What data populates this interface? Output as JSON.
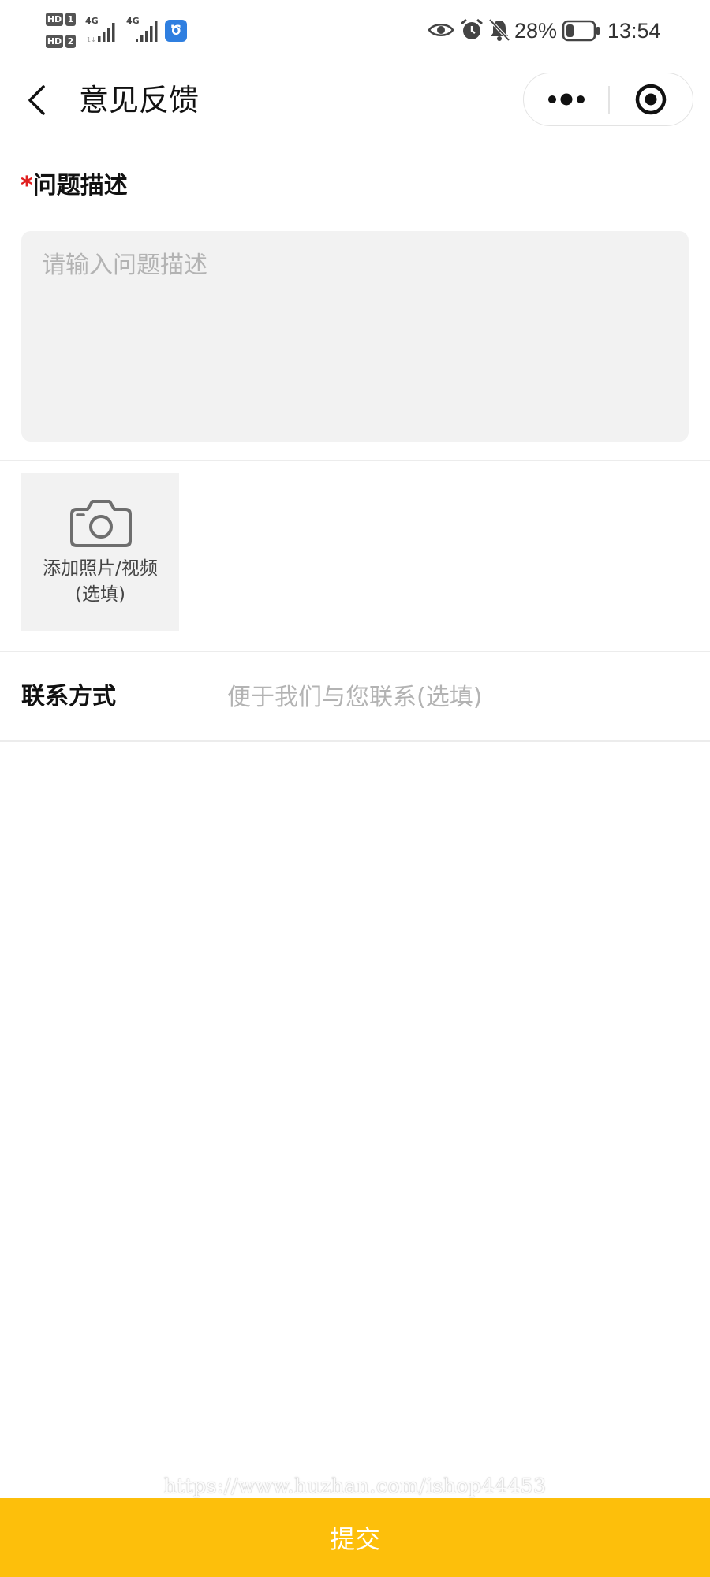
{
  "status_bar": {
    "sim1_label": "HD",
    "sim1_num": "1",
    "sim2_label": "HD",
    "sim2_num": "2",
    "network1": "4G",
    "network2": "4G",
    "battery_percent": "28%",
    "battery_level": 0.28,
    "time": "13:54",
    "icons": [
      "eye-icon",
      "alarm-icon",
      "mute-bell-icon",
      "battery-icon"
    ]
  },
  "nav": {
    "title": "意见反馈",
    "back_icon": "chevron-left-icon",
    "more_icon": "more-dots-icon",
    "close_icon": "target-circle-icon"
  },
  "form": {
    "description": {
      "required_mark": "*",
      "label": "问题描述",
      "value": "",
      "placeholder": "请输入问题描述"
    },
    "upload": {
      "icon": "camera-icon",
      "label_line1": "添加照片/视频",
      "label_line2": "(选填)"
    },
    "contact": {
      "label": "联系方式",
      "value": "",
      "placeholder": "便于我们与您联系(选填)"
    }
  },
  "watermark": "https://www.huzhan.com/ishop44453",
  "submit": {
    "label": "提交"
  },
  "colors": {
    "accent": "#fdbf0b",
    "required": "#e02020",
    "input_bg": "#f2f2f2",
    "placeholder": "#b3b3b3"
  }
}
